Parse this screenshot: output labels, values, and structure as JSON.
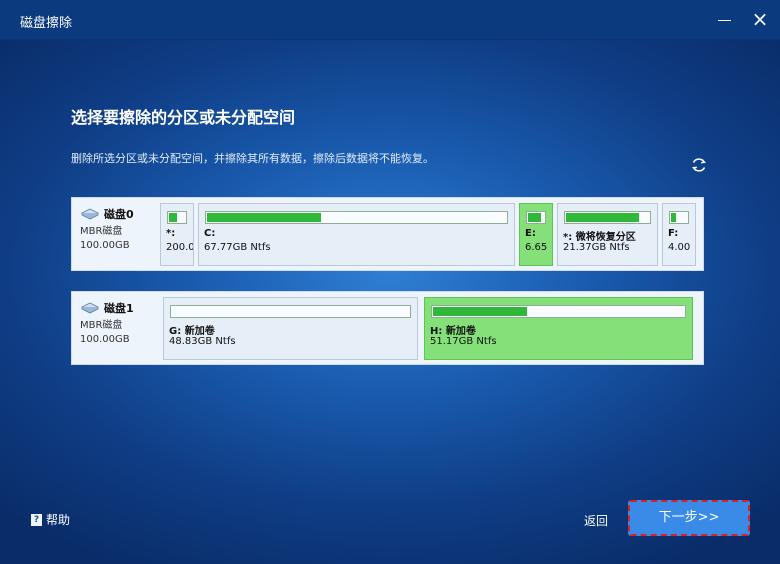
{
  "window": {
    "title": "磁盘擦除",
    "minimize_label": "",
    "close_label": "×"
  },
  "main": {
    "heading": "选择要擦除的分区或未分配空间",
    "description": "删除所选分区或未分配空间，并擦除其所有数据，擦除后数据将不能恢复。"
  },
  "disks": [
    {
      "name": "磁盘0",
      "type": "MBR磁盘",
      "size": "100.00GB",
      "partitions": [
        {
          "label": "*:",
          "size": "200.0",
          "used_fraction": 0.45,
          "selected": false
        },
        {
          "label": "C:",
          "size": "67.77GB Ntfs",
          "used_fraction": 0.38,
          "selected": false
        },
        {
          "label": "E:",
          "size": "6.65",
          "used_fraction": 0.7,
          "selected": true
        },
        {
          "label": "*: 微将恢复分区",
          "size": "21.37GB Ntfs",
          "used_fraction": 0.86,
          "selected": false
        },
        {
          "label": "F:",
          "size": "4.00",
          "used_fraction": 0.3,
          "selected": false
        }
      ]
    },
    {
      "name": "磁盘1",
      "type": "MBR磁盘",
      "size": "100.00GB",
      "partitions": [
        {
          "label": "G: 新加卷",
          "size": "48.83GB Ntfs",
          "used_fraction": 0.0,
          "selected": false
        },
        {
          "label": "H: 新加卷",
          "size": "51.17GB Ntfs",
          "used_fraction": 0.37,
          "selected": true
        }
      ]
    }
  ],
  "footer": {
    "help_label": "帮助",
    "back_label": "返回",
    "next_label": "下一步>>"
  },
  "colors": {
    "accent": "#3a8ae8",
    "selected_partition": "#86e07a",
    "used_fill": "#2fb83a",
    "focus_border": "#e02020"
  }
}
